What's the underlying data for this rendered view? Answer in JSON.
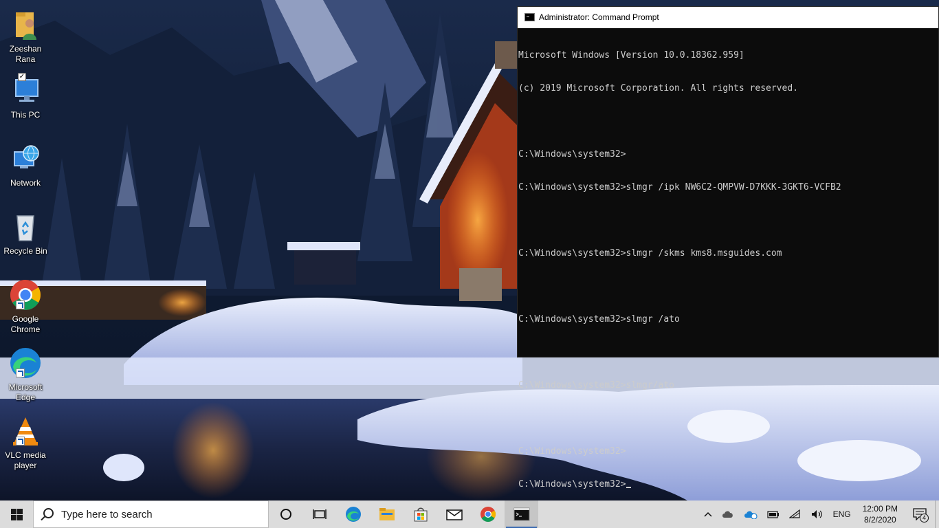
{
  "desktop": {
    "icons": [
      {
        "label": "Zeeshan Rana",
        "icon": "user-folder-icon"
      },
      {
        "label": "This PC",
        "icon": "computer-icon"
      },
      {
        "label": "Network",
        "icon": "network-icon"
      },
      {
        "label": "Recycle Bin",
        "icon": "recycle-bin-icon"
      },
      {
        "label": "Google Chrome",
        "icon": "chrome-icon"
      },
      {
        "label": "Microsoft Edge",
        "icon": "edge-icon"
      },
      {
        "label": "VLC media player",
        "icon": "vlc-icon"
      }
    ]
  },
  "cmd": {
    "title": "Administrator: Command Prompt",
    "lines": [
      "Microsoft Windows [Version 10.0.18362.959]",
      "(c) 2019 Microsoft Corporation. All rights reserved.",
      "",
      "C:\\Windows\\system32>",
      "C:\\Windows\\system32>slmgr /ipk NW6C2-QMPVW-D7KKK-3GKT6-VCFB2",
      "",
      "C:\\Windows\\system32>slmgr /skms kms8.msguides.com",
      "",
      "C:\\Windows\\system32>slmgr /ato",
      "",
      "C:\\Windows\\system32>slmgr/ato",
      "",
      "C:\\Windows\\system32>",
      "C:\\Windows\\system32>"
    ]
  },
  "taskbar": {
    "search_placeholder": "Type here to search",
    "pinned": [
      "cortana-icon",
      "task-view-icon",
      "edge-icon",
      "file-explorer-icon",
      "microsoft-store-icon",
      "mail-icon",
      "chrome-icon",
      "command-prompt-icon"
    ],
    "tray": {
      "language": "ENG",
      "time": "12:00 PM",
      "date": "8/2/2020",
      "notification_count": "4"
    }
  },
  "colors": {
    "taskbar_bg": "#dcdcdc",
    "cmd_bg": "#0c0c0c",
    "cmd_text": "#cccccc",
    "accent": "#3a6ab0"
  }
}
